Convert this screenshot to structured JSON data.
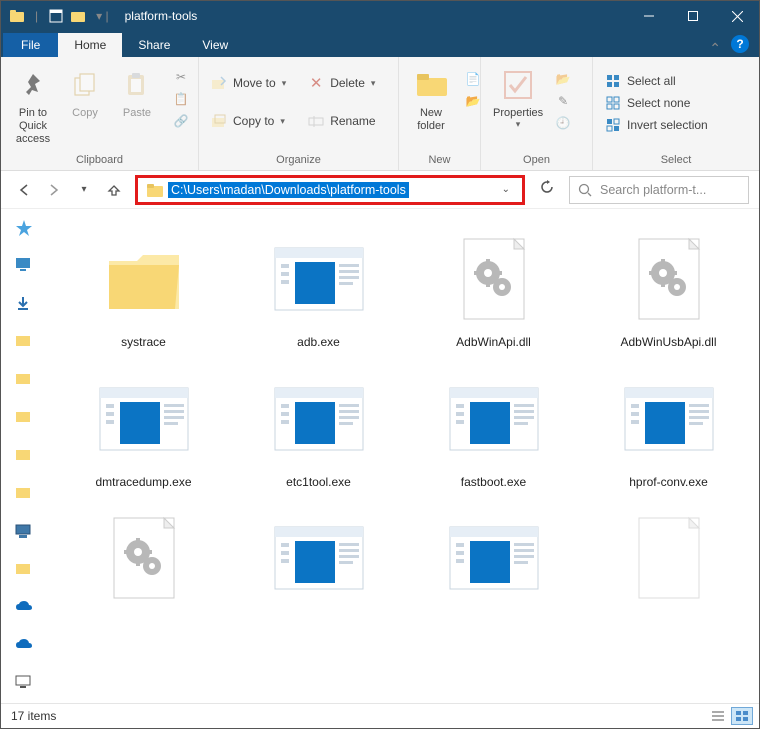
{
  "title": "platform-tools",
  "tabs": {
    "file": "File",
    "home": "Home",
    "share": "Share",
    "view": "View"
  },
  "ribbon": {
    "clipboard": {
      "label": "Clipboard",
      "pin": "Pin to Quick access",
      "copy": "Copy",
      "paste": "Paste"
    },
    "organize": {
      "label": "Organize",
      "moveto": "Move to",
      "copyto": "Copy to",
      "delete": "Delete",
      "rename": "Rename"
    },
    "new": {
      "label": "New",
      "newfolder": "New folder"
    },
    "open": {
      "label": "Open",
      "properties": "Properties"
    },
    "select": {
      "label": "Select",
      "all": "Select all",
      "none": "Select none",
      "invert": "Invert selection"
    }
  },
  "address": {
    "path": "C:\\Users\\madan\\Downloads\\platform-tools"
  },
  "search": {
    "placeholder": "Search platform-t..."
  },
  "items": [
    {
      "name": "systrace",
      "type": "folder"
    },
    {
      "name": "adb.exe",
      "type": "app"
    },
    {
      "name": "AdbWinApi.dll",
      "type": "dll"
    },
    {
      "name": "AdbWinUsbApi.dll",
      "type": "dll"
    },
    {
      "name": "dmtracedump.exe",
      "type": "app"
    },
    {
      "name": "etc1tool.exe",
      "type": "app"
    },
    {
      "name": "fastboot.exe",
      "type": "app"
    },
    {
      "name": "hprof-conv.exe",
      "type": "app"
    },
    {
      "name": "",
      "type": "dll"
    },
    {
      "name": "",
      "type": "app"
    },
    {
      "name": "",
      "type": "app"
    },
    {
      "name": "",
      "type": "blank"
    }
  ],
  "status": {
    "count": "17 items"
  },
  "colors": {
    "titlebar": "#1a4a6e",
    "accent": "#0078d7",
    "highlight_border": "#e21b1b"
  }
}
